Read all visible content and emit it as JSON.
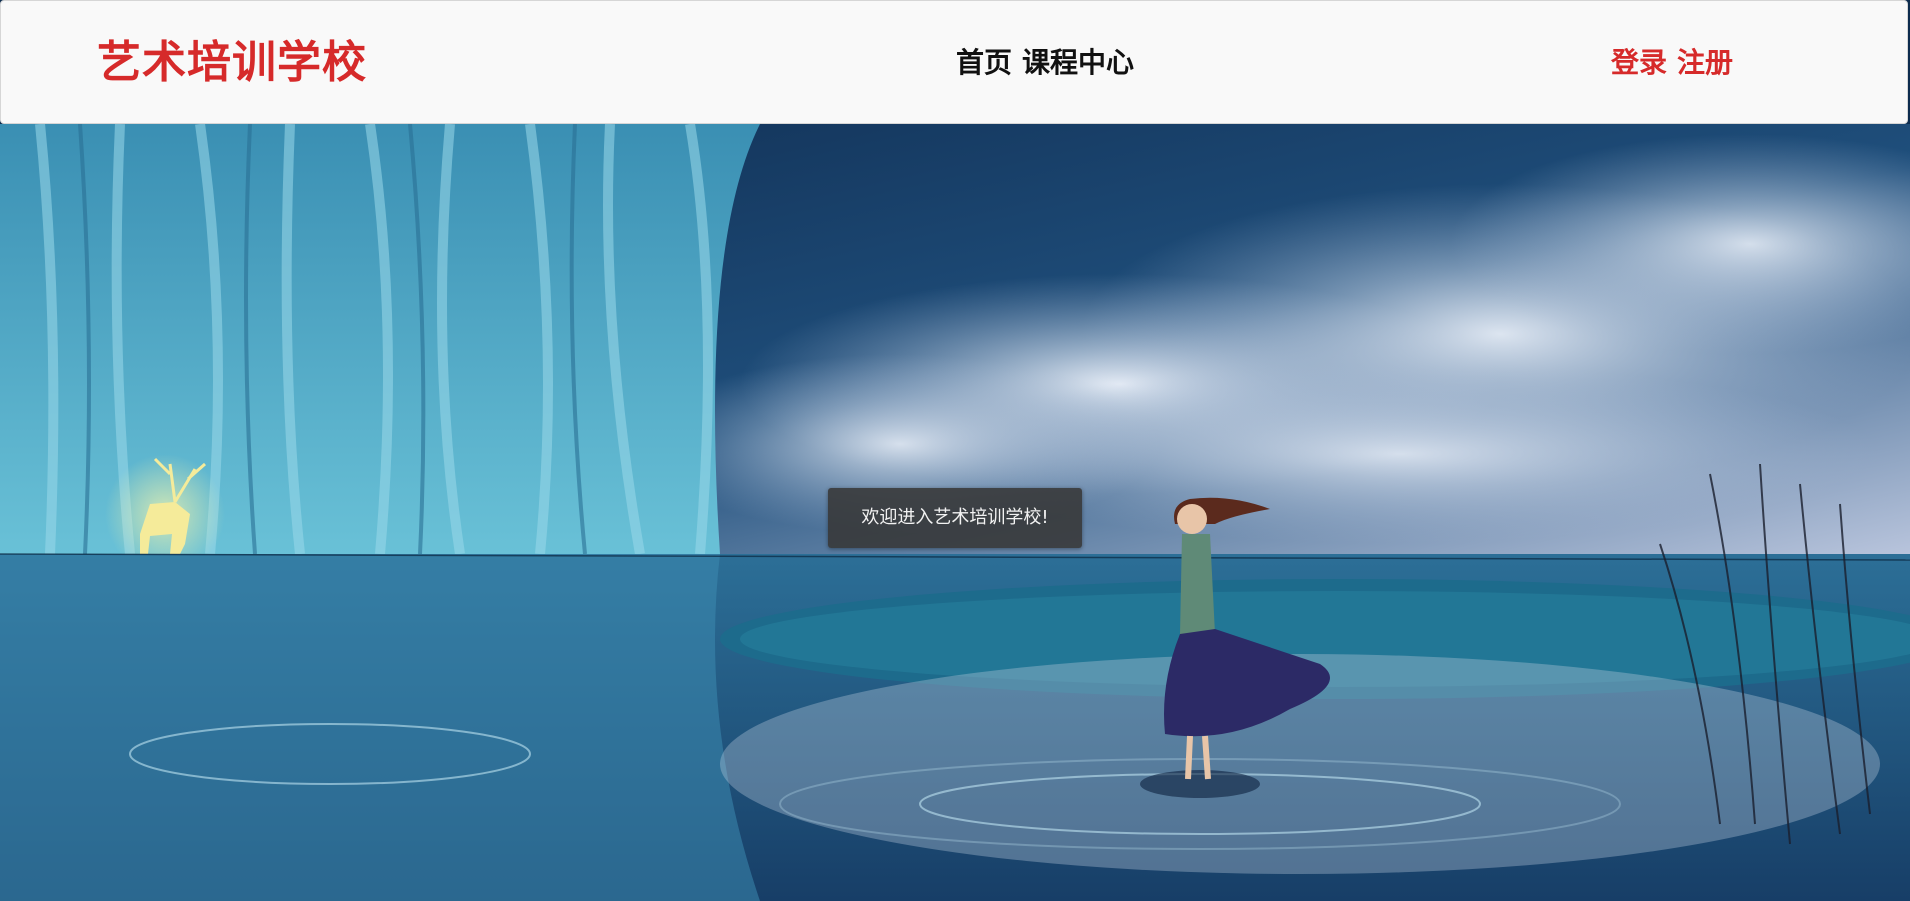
{
  "header": {
    "brand": "艺术培训学校",
    "nav": {
      "home": "首页",
      "courses": "课程中心"
    },
    "auth": {
      "login": "登录",
      "register": "注册"
    }
  },
  "toast": {
    "message": "欢迎进入艺术培训学校!"
  },
  "colors": {
    "brand": "#d62a2a",
    "nav_text": "#111111",
    "navbar_bg": "#f9f9f9",
    "toast_bg": "#373737"
  },
  "hero": {
    "icon": "forest-lake-illustration"
  }
}
